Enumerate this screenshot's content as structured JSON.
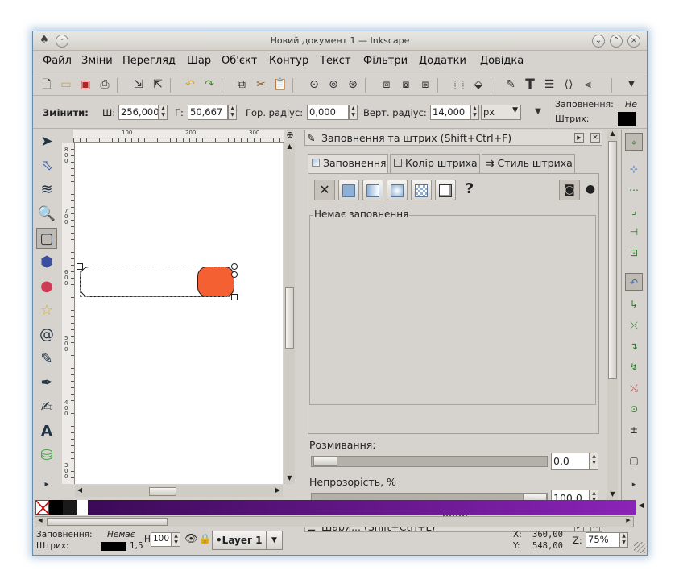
{
  "window": {
    "title": "Новий документ 1 — Inkscape"
  },
  "menu": [
    "Файл",
    "Зміни",
    "Перегляд",
    "Шар",
    "Об'єкт",
    "Контур",
    "Текст",
    "Фільтри",
    "Додатки",
    "Довідка"
  ],
  "tool_controls": {
    "change_label": "Змінити:",
    "w_label": "Ш:",
    "w_value": "256,000",
    "h_label": "Г:",
    "h_value": "50,667",
    "rx_label": "Гор. радіус:",
    "rx_value": "0,000",
    "ry_label": "Верт. радіус:",
    "ry_value": "14,000",
    "unit": "px"
  },
  "style_indicator": {
    "fill_label": "Заповнення:",
    "fill_value": "Не",
    "stroke_label": "Штрих:"
  },
  "ruler_labels": [
    "100",
    "200",
    "300"
  ],
  "ruler_v_labels": [
    "800",
    "700",
    "600",
    "500",
    "400",
    "300"
  ],
  "panel": {
    "title": "Заповнення та штрих (Shift+Ctrl+F)",
    "tabs": [
      "Заповнення",
      "Колір штриха",
      "Стиль штриха"
    ],
    "no_fill_label": "Немає заповнення",
    "blur_label": "Розмивання:",
    "blur_value": "0,0",
    "opacity_label": "Непрозорість, %",
    "opacity_value": "100,0",
    "opacity_level": 1.0,
    "layers_title": "Шари... (Shift+Ctrl+L)"
  },
  "status": {
    "fill_label": "Заповнення:",
    "fill_value": "Немає",
    "stroke_label": "Штрих:",
    "stroke_width": "1,5",
    "h_label": "H:",
    "opacity": "100",
    "layer": "•Layer 1",
    "x_label": "X:",
    "x_value": "360,00",
    "y_label": "Y:",
    "y_value": "548,00",
    "z_label": "Z:",
    "zoom": "75%"
  },
  "colors": {
    "accent_shape": "#f46032",
    "palette_start": "#3b0a57",
    "palette_end": "#8b23b8"
  }
}
